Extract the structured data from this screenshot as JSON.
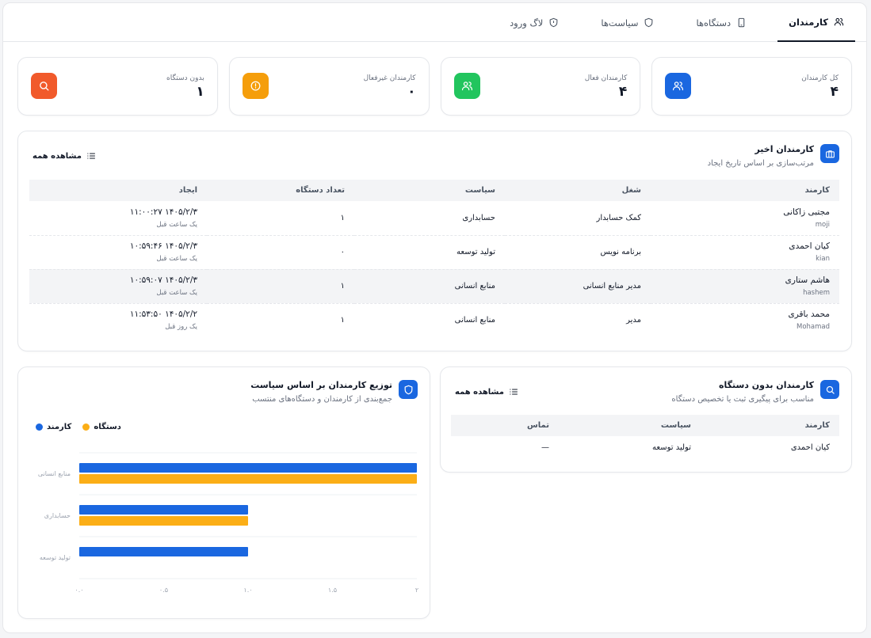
{
  "tabs": [
    {
      "label": "کارمندان",
      "icon": "users-icon",
      "active": true
    },
    {
      "label": "دستگاه‌ها",
      "icon": "phone-icon",
      "active": false
    },
    {
      "label": "سیاست‌ها",
      "icon": "shield-icon",
      "active": false
    },
    {
      "label": "لاگ ورود",
      "icon": "shield-icon",
      "active": false
    }
  ],
  "stats": [
    {
      "label": "کل کارمندان",
      "value": "۴",
      "color": "#1a67e0",
      "icon": "users-icon"
    },
    {
      "label": "کارمندان فعال",
      "value": "۴",
      "color": "#22c55e",
      "icon": "users-icon"
    },
    {
      "label": "کارمندان غیرفعال",
      "value": "۰",
      "color": "#f59e0b",
      "icon": "clock-icon"
    },
    {
      "label": "بدون دستگاه",
      "value": "۱",
      "color": "#f15a2b",
      "icon": "search-icon"
    }
  ],
  "recent": {
    "title": "کارمندان اخیر",
    "subtitle": "مرتب‌سازی بر اساس تاریخ ایجاد",
    "view_all": "مشاهده همه",
    "columns": [
      "کارمند",
      "شغل",
      "سیاست",
      "تعداد دستگاه",
      "ایجاد"
    ],
    "rows": [
      {
        "name": "مجتبی زاکانی",
        "username": "moji",
        "job": "کمک حسابدار",
        "policy": "حسابداری",
        "devices": "۱",
        "created": "۱۴۰۵/۲/۳ ۱۱:۰۰:۲۷",
        "ago": "یک ساعت قبل"
      },
      {
        "name": "کیان احمدی",
        "username": "kian",
        "job": "برنامه نویس",
        "policy": "تولید توسعه",
        "devices": "۰",
        "created": "۱۴۰۵/۲/۳ ۱۰:۵۹:۴۶",
        "ago": "یک ساعت قبل"
      },
      {
        "name": "هاشم ستاری",
        "username": "hashem",
        "job": "مدیر منابع انسانی",
        "policy": "منابع انسانی",
        "devices": "۱",
        "created": "۱۴۰۵/۲/۳ ۱۰:۵۹:۰۷",
        "ago": "یک ساعت قبل"
      },
      {
        "name": "محمد باقری",
        "username": "Mohamad",
        "job": "مدیر",
        "policy": "منابع انسانی",
        "devices": "۱",
        "created": "۱۴۰۵/۲/۲ ۱۱:۵۳:۵۰",
        "ago": "یک روز قبل"
      }
    ]
  },
  "no_device": {
    "title": "کارمندان بدون دستگاه",
    "subtitle": "مناسب برای پیگیری ثبت یا تخصیص دستگاه",
    "view_all": "مشاهده همه",
    "columns": [
      "کارمند",
      "سیاست",
      "تماس"
    ],
    "rows": [
      {
        "name": "کیان احمدی",
        "policy": "تولید توسعه",
        "contact": "—"
      }
    ]
  },
  "distribution": {
    "title": "توزیع کارمندان بر اساس سیاست",
    "subtitle": "جمع‌بندی از کارمندان و دستگاه‌های منتسب"
  },
  "chart_data": {
    "type": "bar",
    "orientation": "horizontal",
    "categories": [
      "منابع انسانی",
      "حسابداری",
      "تولید توسعه"
    ],
    "series": [
      {
        "name": "کارمند",
        "color": "#1a67e0",
        "values": [
          2,
          1,
          1
        ]
      },
      {
        "name": "دستگاه",
        "color": "#fbae17",
        "values": [
          2,
          1,
          0
        ]
      }
    ],
    "xlim": [
      0,
      2
    ],
    "xticks": [
      0,
      0.5,
      1,
      1.5,
      2
    ],
    "xtick_labels": [
      "۰.۰",
      "۰.۵",
      "۱.۰",
      "۱.۵",
      "۲"
    ],
    "grid": true,
    "legend": "top-left"
  }
}
